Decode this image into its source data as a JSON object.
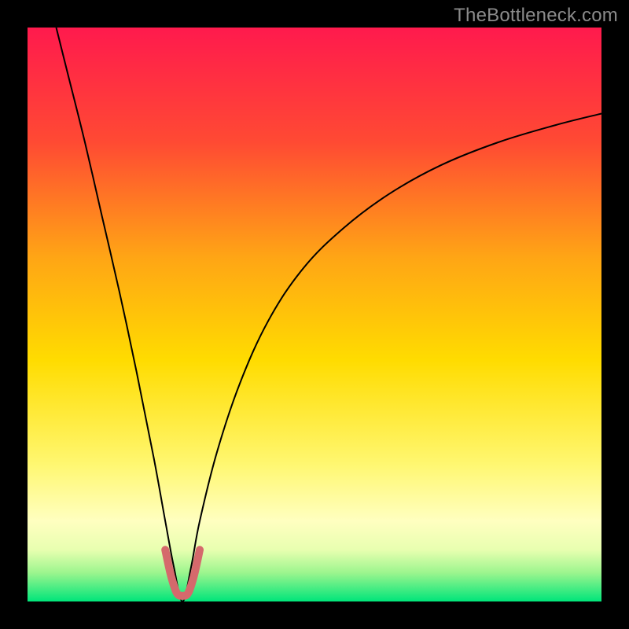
{
  "watermark": "TheBottleneck.com",
  "chart_data": {
    "type": "line",
    "title": "",
    "xlabel": "",
    "ylabel": "",
    "xlim": [
      0,
      100
    ],
    "ylim": [
      0,
      100
    ],
    "grid": false,
    "legend": false,
    "gradient_stops": [
      {
        "pos": 0.0,
        "color": "#ff1a4d"
      },
      {
        "pos": 0.2,
        "color": "#ff4a33"
      },
      {
        "pos": 0.4,
        "color": "#ffa515"
      },
      {
        "pos": 0.58,
        "color": "#ffdc00"
      },
      {
        "pos": 0.76,
        "color": "#fff770"
      },
      {
        "pos": 0.86,
        "color": "#ffffc0"
      },
      {
        "pos": 0.91,
        "color": "#e8ffb0"
      },
      {
        "pos": 0.95,
        "color": "#9cf58e"
      },
      {
        "pos": 1.0,
        "color": "#00e57a"
      }
    ],
    "optimal_x": 27,
    "series": [
      {
        "name": "bottleneck-curve",
        "color": "#000000",
        "stroke_width": 2,
        "points": [
          {
            "x": 5.0,
            "y": 100.0
          },
          {
            "x": 7.0,
            "y": 92.0
          },
          {
            "x": 10.0,
            "y": 80.0
          },
          {
            "x": 13.0,
            "y": 67.0
          },
          {
            "x": 16.0,
            "y": 54.0
          },
          {
            "x": 19.0,
            "y": 40.0
          },
          {
            "x": 22.0,
            "y": 25.0
          },
          {
            "x": 24.0,
            "y": 14.0
          },
          {
            "x": 25.5,
            "y": 6.0
          },
          {
            "x": 27.0,
            "y": 0.0
          },
          {
            "x": 28.5,
            "y": 6.0
          },
          {
            "x": 30.0,
            "y": 14.0
          },
          {
            "x": 33.0,
            "y": 26.0
          },
          {
            "x": 37.0,
            "y": 38.0
          },
          {
            "x": 42.0,
            "y": 49.0
          },
          {
            "x": 48.0,
            "y": 58.0
          },
          {
            "x": 55.0,
            "y": 65.0
          },
          {
            "x": 63.0,
            "y": 71.0
          },
          {
            "x": 72.0,
            "y": 76.0
          },
          {
            "x": 82.0,
            "y": 80.0
          },
          {
            "x": 92.0,
            "y": 83.0
          },
          {
            "x": 100.0,
            "y": 85.0
          }
        ]
      },
      {
        "name": "highlighted-range",
        "color": "#d5696c",
        "stroke_width": 10,
        "linecap": "round",
        "points": [
          {
            "x": 24.0,
            "y": 9.0
          },
          {
            "x": 25.0,
            "y": 4.5
          },
          {
            "x": 26.0,
            "y": 1.5
          },
          {
            "x": 27.0,
            "y": 1.0
          },
          {
            "x": 28.0,
            "y": 1.5
          },
          {
            "x": 29.0,
            "y": 4.5
          },
          {
            "x": 30.0,
            "y": 9.0
          }
        ]
      }
    ]
  }
}
